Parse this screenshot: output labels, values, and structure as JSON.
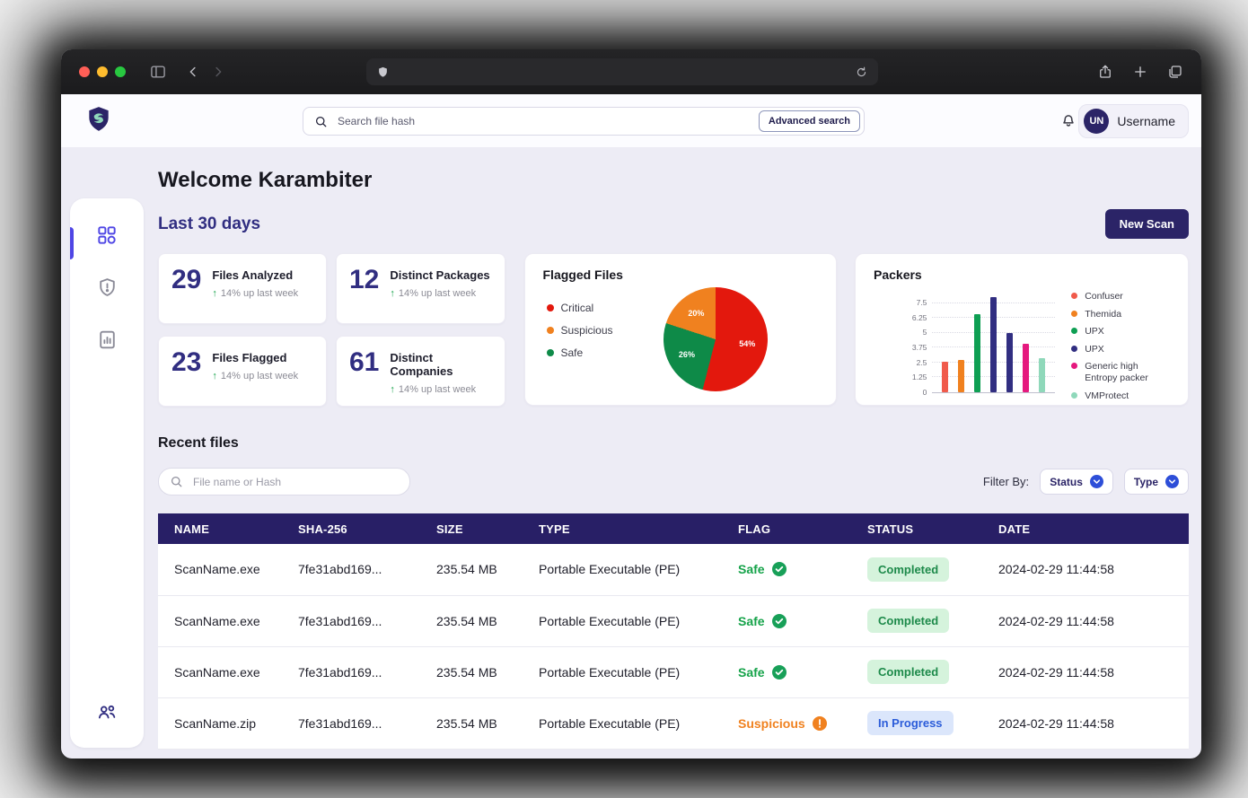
{
  "header": {
    "search_placeholder": "Search file hash",
    "advanced_button": "Advanced search",
    "avatar_initials": "UN",
    "username": "Username"
  },
  "sidebar": {
    "items": [
      "dashboard",
      "threats",
      "reports"
    ],
    "bottom_items": [
      "team"
    ]
  },
  "page": {
    "welcome": "Welcome Karambiter",
    "period": "Last 30 days",
    "new_scan": "New Scan",
    "recent_title": "Recent files",
    "file_search_placeholder": "File name or Hash",
    "filter_by": "Filter By:",
    "filters": [
      {
        "label": "Status"
      },
      {
        "label": "Type"
      }
    ]
  },
  "stats": {
    "cards": [
      {
        "value": "29",
        "label": "Files Analyzed",
        "delta": "14% up last week"
      },
      {
        "value": "12",
        "label": "Distinct Packages",
        "delta": "14% up last week"
      },
      {
        "value": "23",
        "label": "Files Flagged",
        "delta": "14% up last week"
      },
      {
        "value": "61",
        "label": "Distinct Companies",
        "delta": "14% up last week"
      }
    ]
  },
  "chart_data": [
    {
      "type": "pie",
      "title": "Flagged Files",
      "slices": [
        {
          "label": "Critical",
          "value": 54,
          "color": "#e3180d"
        },
        {
          "label": "Safe",
          "value": 26,
          "color": "#0e8a48"
        },
        {
          "label": "Suspicious",
          "value": 20,
          "color": "#f0811f"
        }
      ],
      "legend": [
        {
          "label": "Critical",
          "color": "#e3180d"
        },
        {
          "label": "Suspicious",
          "color": "#f0811f"
        },
        {
          "label": "Safe",
          "color": "#0e8a48"
        }
      ],
      "legend_position": "left"
    },
    {
      "type": "bar",
      "title": "Packers",
      "ylim": [
        0,
        8.4
      ],
      "yticks": [
        7.5,
        6.25,
        5,
        3.75,
        2.5,
        1.25,
        0
      ],
      "grid": true,
      "bars": [
        {
          "series": "Confuser",
          "value": 2.6,
          "color": "#f05a4b"
        },
        {
          "series": "Themida",
          "value": 2.7,
          "color": "#f0811f"
        },
        {
          "series": "UPX",
          "value": 6.6,
          "color": "#0e9f53"
        },
        {
          "series": "UPX",
          "value": 8.0,
          "color": "#312e81"
        },
        {
          "series": "UPX",
          "value": 5.0,
          "color": "#312e81"
        },
        {
          "series": "Generic high Entropy packer",
          "value": 4.1,
          "color": "#e5197e"
        },
        {
          "series": "VMProtect",
          "value": 2.9,
          "color": "#8fd8ba"
        }
      ],
      "legend": [
        {
          "label": "Confuser",
          "color": "#f05a4b"
        },
        {
          "label": "Themida",
          "color": "#f0811f"
        },
        {
          "label": "UPX",
          "color": "#0e9f53"
        },
        {
          "label": "UPX",
          "color": "#312e81"
        },
        {
          "label": "Generic high Entropy packer",
          "color": "#e5197e"
        },
        {
          "label": "VMProtect",
          "color": "#8fd8ba"
        }
      ],
      "legend_position": "right"
    }
  ],
  "table": {
    "headers": [
      "NAME",
      "SHA-256",
      "SIZE",
      "TYPE",
      "FLAG",
      "STATUS",
      "DATE"
    ],
    "rows": [
      {
        "name": "ScanName.exe",
        "sha": "7fe31abd169...",
        "size": "235.54 MB",
        "type": "Portable Executable (PE)",
        "flag": {
          "label": "Safe",
          "kind": "safe"
        },
        "status": {
          "label": "Completed",
          "kind": "completed"
        },
        "date": "2024-02-29 11:44:58"
      },
      {
        "name": "ScanName.exe",
        "sha": "7fe31abd169...",
        "size": "235.54 MB",
        "type": "Portable Executable (PE)",
        "flag": {
          "label": "Safe",
          "kind": "safe"
        },
        "status": {
          "label": "Completed",
          "kind": "completed"
        },
        "date": "2024-02-29 11:44:58"
      },
      {
        "name": "ScanName.exe",
        "sha": "7fe31abd169...",
        "size": "235.54 MB",
        "type": "Portable Executable (PE)",
        "flag": {
          "label": "Safe",
          "kind": "safe"
        },
        "status": {
          "label": "Completed",
          "kind": "completed"
        },
        "date": "2024-02-29 11:44:58"
      },
      {
        "name": "ScanName.zip",
        "sha": "7fe31abd169...",
        "size": "235.54 MB",
        "type": "Portable Executable (PE)",
        "flag": {
          "label": "Suspicious",
          "kind": "suspicious"
        },
        "status": {
          "label": "In Progress",
          "kind": "in-progress"
        },
        "date": "2024-02-29 11:44:58"
      }
    ]
  },
  "colors": {
    "brand_indigo": "#2b2467",
    "accent_purple": "#4f46e5",
    "success_green": "#16a34a",
    "warning_orange": "#f0811f",
    "critical_red": "#e3180d",
    "info_blue": "#2b5cd9"
  }
}
